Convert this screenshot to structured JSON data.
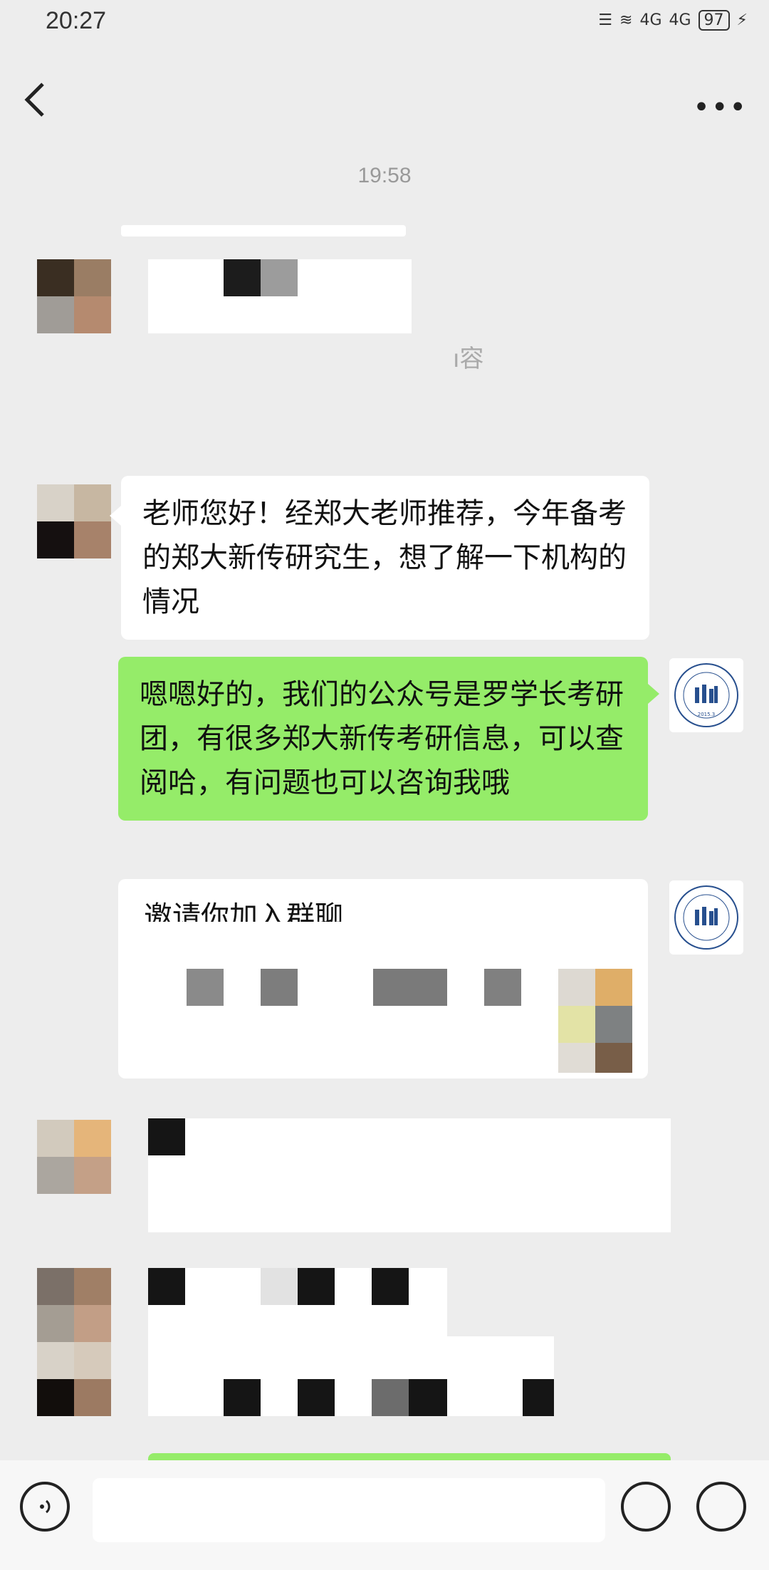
{
  "status_bar": {
    "time": "20:27",
    "battery": "97",
    "signal_1": "4G",
    "signal_2": "4G"
  },
  "header": {
    "back_icon": "chevron-left-icon",
    "more_label": "•••"
  },
  "chat": {
    "timestamp": "19:58",
    "partial_text_1": "ı容",
    "message_1": "老师您好！经郑大老师推荐，今年备考　　的郑大新传研究生，想了解一下机构的情况",
    "message_2": "嗯嗯好的，我们的公众号是罗学长考研团，有很多郑大新传考研信息，可以查阅哈，有问题也可以咨询我哦",
    "invite_partial": "邀请你加入群聊",
    "logo_text": "LUO XUE ZHANG KAO YAN",
    "logo_year": "2015.3"
  },
  "colors": {
    "bg": "#ededed",
    "bubble_green": "#95ec69",
    "bubble_white": "#ffffff"
  }
}
